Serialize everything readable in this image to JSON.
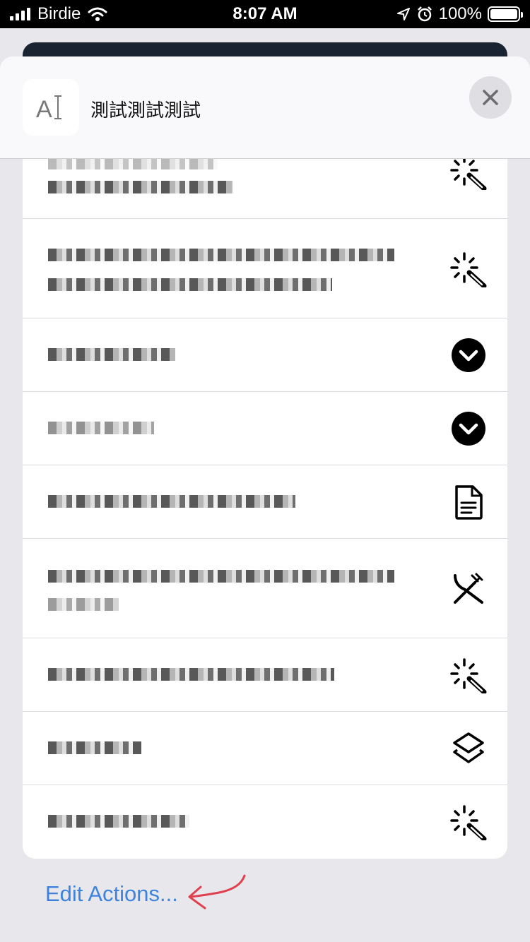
{
  "status_bar": {
    "carrier": "Birdie",
    "time": "8:07 AM",
    "battery": "100%"
  },
  "header": {
    "icon": "text-cursor-icon",
    "title": "測試測試測試",
    "close_icon": "close-icon"
  },
  "actions": [
    {
      "icon": "magic-wand-icon"
    },
    {
      "icon": "magic-wand-icon"
    },
    {
      "icon": "chevron-down-circle-icon"
    },
    {
      "icon": "chevron-down-circle-icon"
    },
    {
      "icon": "document-icon"
    },
    {
      "icon": "fork-knife-icon"
    },
    {
      "icon": "magic-wand-icon"
    },
    {
      "icon": "layers-icon"
    },
    {
      "icon": "magic-wand-icon"
    }
  ],
  "footer": {
    "edit_actions_label": "Edit Actions...",
    "annotation_color": "#e0414f"
  },
  "colors": {
    "accent": "#3d83de",
    "sheet_bg": "#e8e8ec"
  }
}
